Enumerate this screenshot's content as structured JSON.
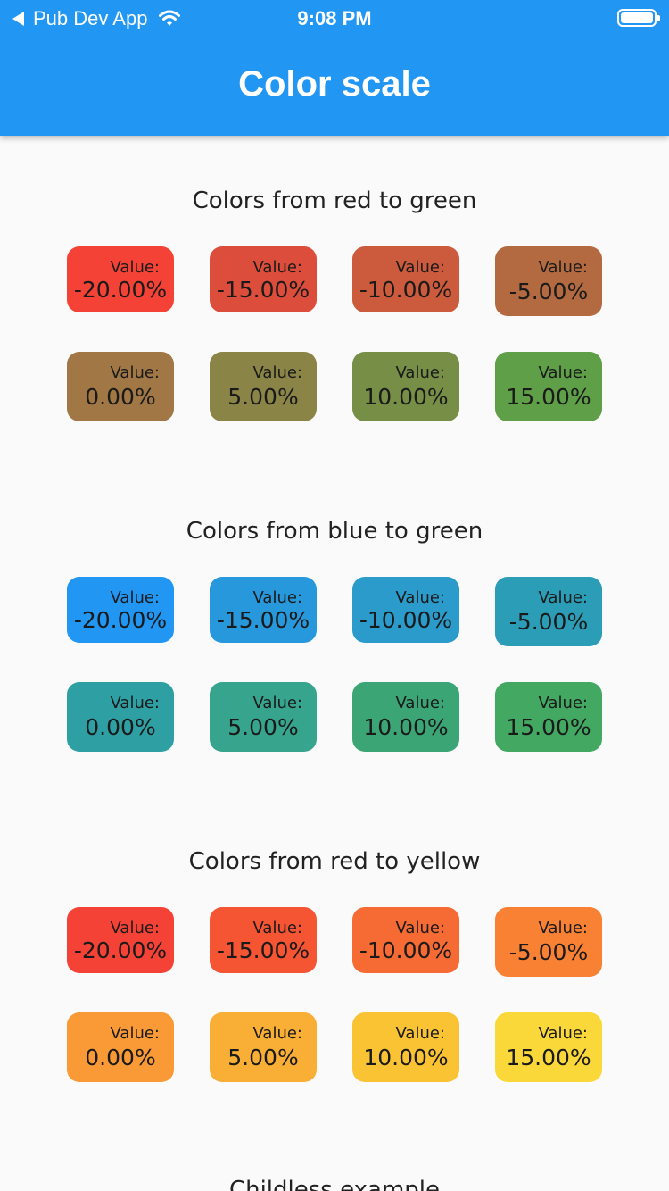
{
  "status_bar": {
    "back_app": "Pub Dev App",
    "time": "9:08 PM"
  },
  "app_bar": {
    "title": "Color scale"
  },
  "value_label": "Value:",
  "sections": [
    {
      "title": "Colors from red to green",
      "tiles": [
        {
          "value": "-20.00%",
          "color": "#f44336"
        },
        {
          "value": "-15.00%",
          "color": "#dc4e3b"
        },
        {
          "value": "-10.00%",
          "color": "#cc5a3c"
        },
        {
          "value": "-5.00%",
          "color": "#b36a40"
        },
        {
          "value": "0.00%",
          "color": "#a17845"
        },
        {
          "value": "5.00%",
          "color": "#8b8447"
        },
        {
          "value": "10.00%",
          "color": "#778e47"
        },
        {
          "value": "15.00%",
          "color": "#5f9f48"
        }
      ]
    },
    {
      "title": "Colors from blue to green",
      "tiles": [
        {
          "value": "-20.00%",
          "color": "#2196f3"
        },
        {
          "value": "-15.00%",
          "color": "#2898dd"
        },
        {
          "value": "-10.00%",
          "color": "#2a9bca"
        },
        {
          "value": "-5.00%",
          "color": "#2c9db6"
        },
        {
          "value": "0.00%",
          "color": "#2ea0a3"
        },
        {
          "value": "5.00%",
          "color": "#37a48d"
        },
        {
          "value": "10.00%",
          "color": "#3ba576"
        },
        {
          "value": "15.00%",
          "color": "#43a862"
        }
      ]
    },
    {
      "title": "Colors from red to yellow",
      "tiles": [
        {
          "value": "-20.00%",
          "color": "#f44336"
        },
        {
          "value": "-15.00%",
          "color": "#f65534"
        },
        {
          "value": "-10.00%",
          "color": "#f66b34"
        },
        {
          "value": "-5.00%",
          "color": "#f88134"
        },
        {
          "value": "0.00%",
          "color": "#f99a36"
        },
        {
          "value": "5.00%",
          "color": "#f9ae35"
        },
        {
          "value": "10.00%",
          "color": "#fac334"
        },
        {
          "value": "15.00%",
          "color": "#fbd83a"
        }
      ]
    }
  ],
  "footer": {
    "title": "Childless example"
  }
}
